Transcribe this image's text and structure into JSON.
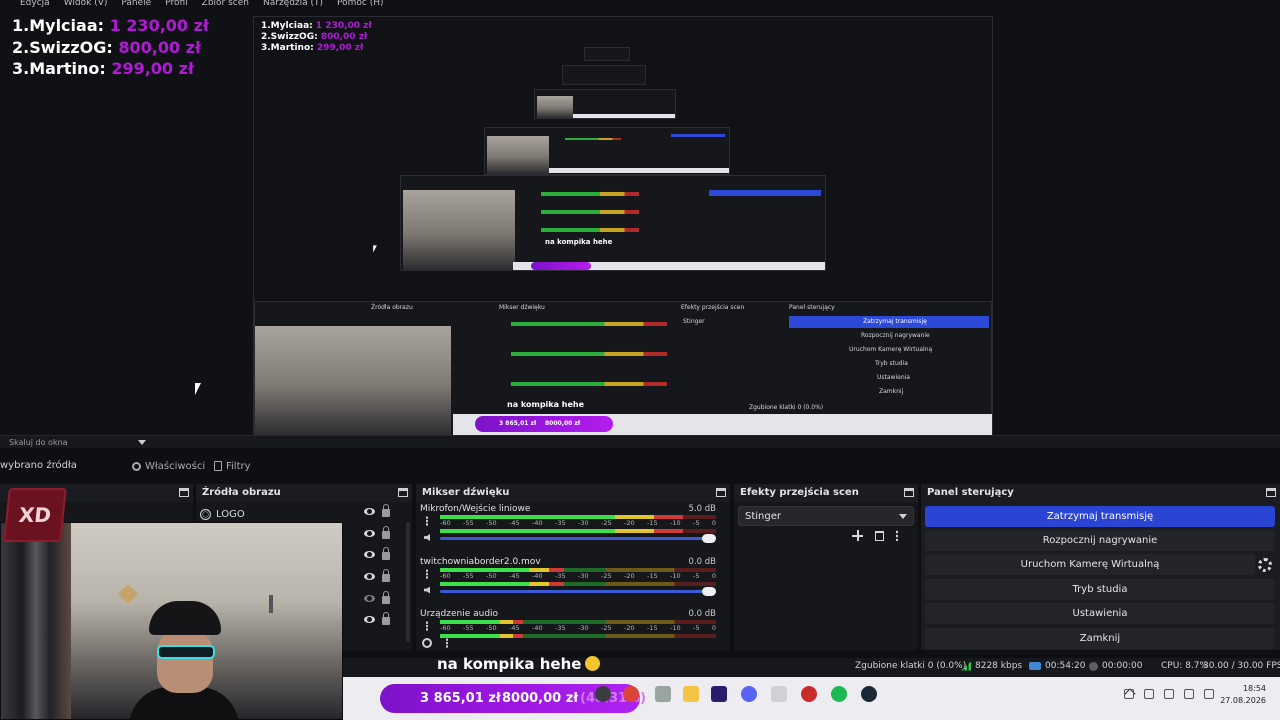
{
  "menubar": {
    "items": [
      "Edycja",
      "Widok (V)",
      "Panele",
      "Profil",
      "Zbiór scen",
      "Narzędzia (T)",
      "Pomoc (H)"
    ]
  },
  "leaderboard": [
    {
      "rank_name": "1.Mylciaa:",
      "amount": "1 230,00 zł"
    },
    {
      "rank_name": "2.SwizzOG:",
      "amount": "800,00 zł"
    },
    {
      "rank_name": "3.Martino:",
      "amount": "299,00 zł"
    }
  ],
  "scale": {
    "label": "Skaluj do okna"
  },
  "source_toolbar": {
    "no_selection": "wybrano źródła",
    "properties": "Właściwości",
    "filters": "Filtry"
  },
  "docks": {
    "sources": {
      "title": "Źródła obrazu",
      "items": [
        "LOGO"
      ]
    },
    "mixer": {
      "title": "Mikser dźwięku",
      "ticks": [
        "-60",
        "-55",
        "-50",
        "-45",
        "-40",
        "-35",
        "-30",
        "-25",
        "-20",
        "-15",
        "-10",
        "-5",
        "0"
      ],
      "tracks": [
        {
          "name": "Mikrofon/Wejście liniowe",
          "db": "5.0 dB",
          "level": 0.88
        },
        {
          "name": "twitchowniaborder2.0.mov",
          "db": "0.0 dB",
          "level": 0.45
        },
        {
          "name": "Urządzenie audio",
          "db": "0.0 dB",
          "level": 0.3
        }
      ]
    },
    "transitions": {
      "title": "Efekty przejścia scen",
      "selected": "Stinger"
    },
    "controls": {
      "title": "Panel sterujący",
      "stop_stream": "Zatrzymaj transmisję",
      "start_recording": "Rozpocznij nagrywanie",
      "virtual_camera": "Uruchom Kamerę Wirtualną",
      "studio_mode": "Tryb studia",
      "settings": "Ustawienia",
      "exit": "Zamknij"
    }
  },
  "webcam_overlay": {
    "logo_text": "XD"
  },
  "caption": {
    "text": "na kompika hehe"
  },
  "statusbar": {
    "dropped_frames": "Zgubione klatki 0 (0.0%)",
    "bitrate": "8228 kbps",
    "stream_time": "00:54:20",
    "rec_time": "00:00:00",
    "cpu": "CPU: 8.7%",
    "fps": "30.00 / 30.00 FPS"
  },
  "donation_goal": {
    "current": "3 865,01 zł",
    "goal": "8000,00 zł",
    "percent": "(48.31%)"
  },
  "taskbar": {
    "time": "18:54",
    "date": "27.08.2026"
  },
  "colors": {
    "accent_blue": "#2a44d4",
    "donation_purple": "#9a16e0",
    "amount_purple": "#b01ad6"
  }
}
